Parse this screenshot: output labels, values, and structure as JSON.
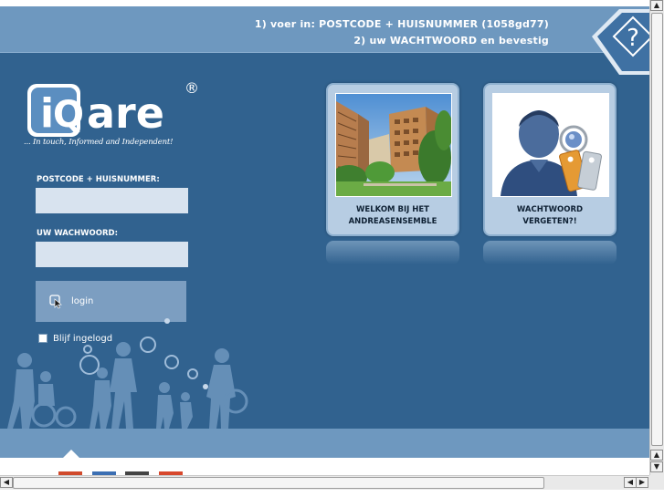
{
  "header": {
    "line1": "1) voer in: POSTCODE + HUISNUMMER (1058gd77)",
    "line2": "2) uw WACHTWOORD en bevestig",
    "help_symbol": "?"
  },
  "logo": {
    "letters_i": "i",
    "letters_q": "Q",
    "letters_are": "are",
    "registered": "®",
    "tagline": "... In touch, Informed and Independent!"
  },
  "login": {
    "postcode_label": "POSTCODE + HUISNUMMER:",
    "postcode_value": "",
    "password_label": "UW WACHWOORD:",
    "password_value": "",
    "button_label": "login",
    "button_icon": "cursor-pointer-icon",
    "stay_logged_in_label": "Blijf ingelogd",
    "stay_logged_in_checked": false
  },
  "tiles": [
    {
      "line1": "WELKOM BIJ HET",
      "line2": "ANDREASENSEMBLE",
      "image": "building-photo"
    },
    {
      "line1": "WACHTWOORD",
      "line2": "VERGETEN?!",
      "image": "person-with-keys"
    }
  ],
  "colors": {
    "background": "#31628f",
    "band": "#6e98bf",
    "tile": "#b7cde3",
    "input": "#d8e3ef"
  },
  "scrollbars": {
    "up_arrow": "▲",
    "down_arrow": "▼",
    "left_arrow": "◀",
    "right_arrow": "▶"
  }
}
